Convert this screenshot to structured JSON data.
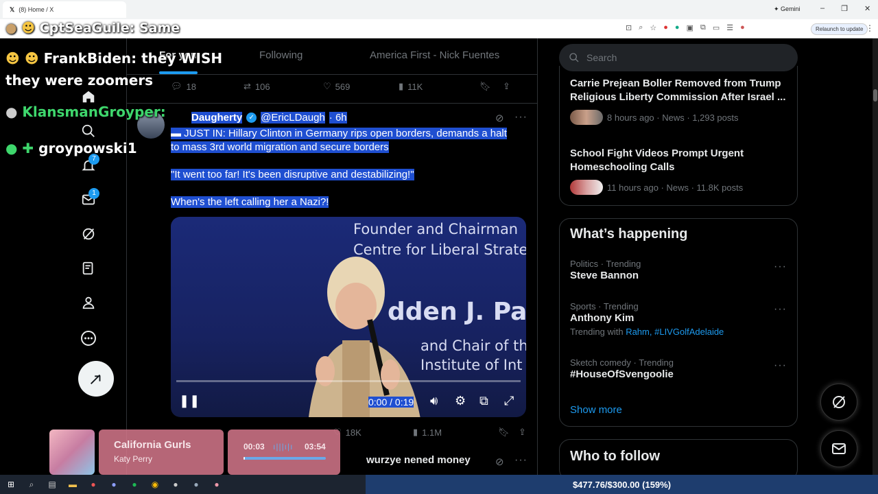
{
  "browser": {
    "tab_title": "(8) Home / X",
    "gemini_label": "Gemini",
    "relaunch_label": "Relaunch to update",
    "window_controls": [
      "–",
      "❐",
      "✕"
    ]
  },
  "chat_overlay": {
    "messages": [
      {
        "user": "CptSeaGuile:",
        "text": "Same"
      },
      {
        "user": "FrankBiden:",
        "text": "they WISH"
      },
      {
        "user": "",
        "text": "they were zoomers"
      },
      {
        "user": "KlansmanGroyper:",
        "text": ""
      },
      {
        "user": "groypowski1",
        "text": ""
      }
    ]
  },
  "tabs": {
    "for_you": "For you",
    "following": "Following",
    "list": "America First - Nick Fuentes"
  },
  "prev_tweet_actions": {
    "replies": "18",
    "retweets": "106",
    "likes": "569",
    "views": "11K"
  },
  "tweet": {
    "name": "Daugherty",
    "handle": "@EricLDaugh",
    "time": "· 6h",
    "line1": " JUST IN: Hillary Clinton in Germany rips open borders, demands a halt",
    "line2": "to mass 3rd world migration and secure borders",
    "quote": "\"It went too far! It's been disruptive and destabilizing!\"",
    "question": "When's the left calling her a Nazi?!",
    "video": {
      "text1": "Founder and Chairman",
      "text2": "Centre for Liberal Strateg",
      "text3": "dden J. Papp",
      "text4": "and Chair of th",
      "text5": "Institute of Int",
      "time": "0:00 / 0:19",
      "progress": 0
    },
    "actions": {
      "likes": "18K",
      "views": "1.1M"
    }
  },
  "next_tweet": {
    "name": "wurzye nened money"
  },
  "search": {
    "placeholder": "Search"
  },
  "news": [
    {
      "title": "Carrie Prejean Boller Removed from Trump Religious Liberty Commission After Israel ...",
      "meta": "8 hours ago · News · 1,293 posts"
    },
    {
      "title": "School Fight Videos Prompt Urgent Homeschooling Calls",
      "meta": "11 hours ago · News · 11.8K posts"
    }
  ],
  "whats_happening": {
    "heading": "What’s happening",
    "trends": [
      {
        "context": "Politics · Trending",
        "name": "Steve Bannon",
        "with_label": "",
        "with": []
      },
      {
        "context": "Sports · Trending",
        "name": "Anthony Kim",
        "with_label": "Trending with",
        "with": [
          "Rahm,",
          "#LIVGolfAdelaide"
        ]
      },
      {
        "context": "Sketch comedy · Trending",
        "name": "#HouseOfSvengoolie",
        "with_label": "",
        "with": []
      }
    ],
    "show_more": "Show more"
  },
  "who_to_follow": {
    "heading": "Who to follow"
  },
  "music": {
    "title": "California Gurls",
    "artist": "Katy Perry",
    "elapsed": "00:03",
    "duration": "03:54",
    "progress": 0.013
  },
  "taskbar": {
    "goal_text": "$477.76/$300.00 (159%)"
  },
  "badges": {
    "notifications": "7",
    "messages": "1"
  },
  "colors": {
    "accent": "#1d9bf0",
    "selection": "#1f4fd1",
    "background": "#000000"
  }
}
